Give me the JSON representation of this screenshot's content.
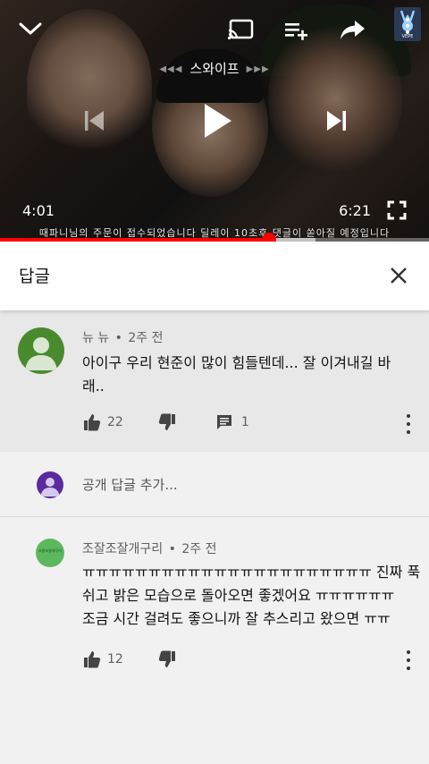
{
  "player": {
    "swipe_label": "스와이프",
    "swipe_left_arrows": "◀◀◀",
    "swipe_right_arrows": "▶▶▶",
    "current_time": "4:01",
    "duration": "6:21",
    "subtitle": "때파니님의 주문이 접수되었습니다 딜레이 10초후 댓글이 쏟아질 예정입니다",
    "progress": 0.628,
    "buffered": 0.735,
    "icons": [
      "chevron-down-icon",
      "cast-icon",
      "add-to-queue-icon",
      "share-icon",
      "channel-logo",
      "more-vert-icon",
      "skip-previous-icon",
      "play-icon",
      "skip-next-icon",
      "fullscreen-icon"
    ],
    "logo_text": "VEPE"
  },
  "replies_panel": {
    "title": "답글",
    "close_icon": "close-icon"
  },
  "parent_comment": {
    "author": "뉴 뉴",
    "age": "2주 전",
    "separator": "•",
    "text_line1": "아이구 우리 현준이 많이 힘들텐데... 잘 이겨내길 바",
    "text_line2": "래..",
    "likes": "22",
    "reply_count": "1",
    "avatar_color": "#4a8a2f"
  },
  "add_reply": {
    "placeholder": "공개 답글 추가...",
    "avatar_color": "#5a2aa0"
  },
  "reply": {
    "author": "조잘조잘개구리",
    "age": "2주 전",
    "separator": "•",
    "text_line1": "ㅠㅠㅠㅠㅠㅠㅠㅠㅠㅠㅠㅠㅠㅠㅠㅠㅠㅠㅠㅠㅠㅠ 진짜 푹",
    "text_line2": "쉬고 밝은 모습으로 돌아오면 좋겠어요 ㅠㅠㅠㅠㅠㅠ",
    "text_line3": "조금 시간 걸려도 좋으니까 잘 추스리고 왔으면 ㅠㅠ",
    "likes": "12",
    "avatar_color": "#5cb85c",
    "avatar_text": "조잘조잘개구리"
  }
}
